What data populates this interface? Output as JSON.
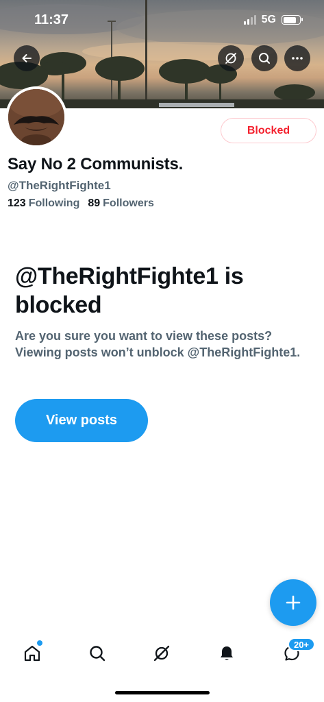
{
  "status_bar": {
    "time": "11:37",
    "network": "5G"
  },
  "profile": {
    "display_name": "Say No 2 Communists.",
    "handle": "@TheRightFighte1",
    "following_count": "123",
    "following_label": "Following",
    "followers_count": "89",
    "followers_label": "Followers",
    "blocked_button_label": "Blocked"
  },
  "blocked_notice": {
    "title": "@TheRightFighte1 is blocked",
    "description": "Are you sure you want to view these posts? Viewing posts won’t unblock @TheRightFighte1.",
    "view_posts_label": "View posts"
  },
  "tab_bar": {
    "messages_badge": "20+"
  },
  "icons": [
    "back-arrow-icon",
    "grok-icon",
    "search-icon",
    "more-icon",
    "compose-plus-icon",
    "home-icon",
    "notifications-bell-icon",
    "messages-icon"
  ],
  "colors": {
    "accent": "#1d9bf0",
    "blocked_red": "#f4212e",
    "secondary_text": "#536471",
    "primary_text": "#0f1419"
  }
}
